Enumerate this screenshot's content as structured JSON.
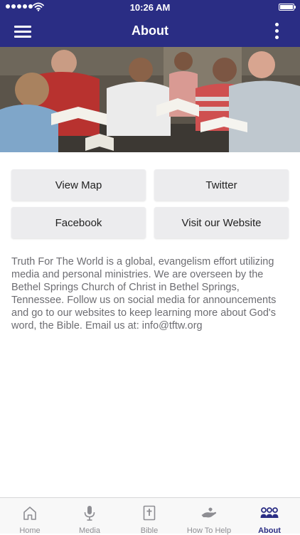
{
  "status_bar": {
    "time": "10:26 AM"
  },
  "nav_bar": {
    "title": "About"
  },
  "buttons": [
    {
      "label": "View Map"
    },
    {
      "label": "Twitter"
    },
    {
      "label": "Facebook"
    },
    {
      "label": "Visit our Website"
    }
  ],
  "about_text": "Truth For The World is a global, evangelism effort utilizing media and personal ministries.  We are overseen by the Bethel Springs Church of Christ in Bethel Springs, Tennessee.  Follow us on social media for announcements and go to our websites to keep learning more about God's word, the Bible.  Email us at: info@tftw.org",
  "tabs": [
    {
      "label": "Home",
      "icon": "home-icon",
      "active": false
    },
    {
      "label": "Media",
      "icon": "microphone-icon",
      "active": false
    },
    {
      "label": "Bible",
      "icon": "bible-icon",
      "active": false
    },
    {
      "label": "How To Help",
      "icon": "helping-hand-icon",
      "active": false
    },
    {
      "label": "About",
      "icon": "people-icon",
      "active": true
    }
  ],
  "colors": {
    "brand": "#2a2d84",
    "tab_inactive": "#8e8e93",
    "button_bg": "#ececee",
    "body_text": "#6d6d72"
  }
}
